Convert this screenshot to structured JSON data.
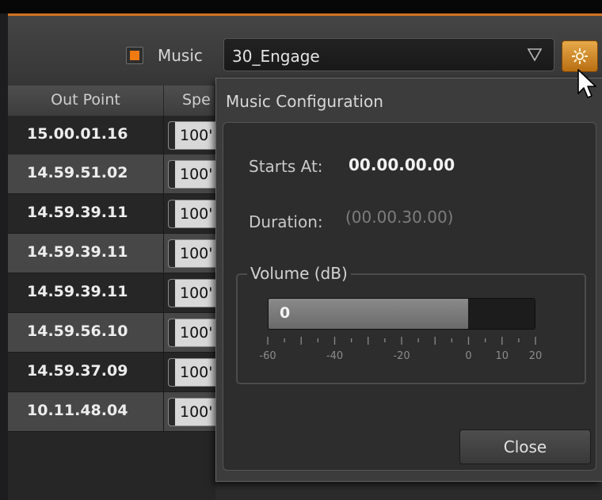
{
  "toolbar": {
    "music_label": "Music",
    "music_enabled": true,
    "music_selected": "30_Engage"
  },
  "table": {
    "columns": [
      "Out Point",
      "Spe"
    ],
    "rows": [
      {
        "out_point": "15.00.01.16",
        "speed": "100'"
      },
      {
        "out_point": "14.59.51.02",
        "speed": "100'"
      },
      {
        "out_point": "14.59.39.11",
        "speed": "100'"
      },
      {
        "out_point": "14.59.39.11",
        "speed": "100'"
      },
      {
        "out_point": "14.59.39.11",
        "speed": "100'"
      },
      {
        "out_point": "14.59.56.10",
        "speed": "100'"
      },
      {
        "out_point": "14.59.37.09",
        "speed": "100'"
      },
      {
        "out_point": "10.11.48.04",
        "speed": "100'"
      }
    ]
  },
  "popup": {
    "title": "Music Configuration",
    "starts_at_label": "Starts At:",
    "starts_at_value": "00.00.00.00",
    "duration_label": "Duration:",
    "duration_value": "(00.00.30.00)",
    "volume_label": "Volume (dB)",
    "volume_value": "0",
    "volume_db": 0,
    "volume_range": [
      -60,
      20
    ],
    "scale_labels": [
      "-60",
      "-40",
      "-20",
      "0",
      "10",
      "20"
    ],
    "close_label": "Close"
  },
  "colors": {
    "accent": "#d07420",
    "checkbox": "#f07a10",
    "gear_button": "#d08a2a"
  }
}
